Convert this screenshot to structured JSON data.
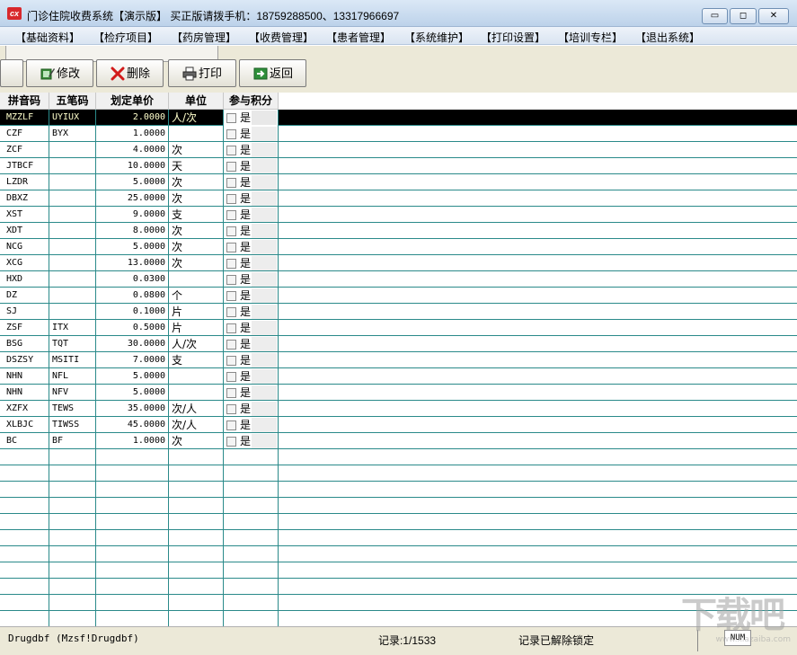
{
  "window": {
    "icon_text": "cx",
    "title": "门诊住院收费系统【演示版】 买正版请拨手机：18759288500、13317966697",
    "minimize_glyph": "▭",
    "maximize_glyph": "◻",
    "close_glyph": "✕"
  },
  "menu": [
    "【基础资料】",
    "【检疗项目】",
    "【药房管理】",
    "【收费管理】",
    "【患者管理】",
    "【系统维护】",
    "【打印设置】",
    "【培训专栏】",
    "【退出系统】"
  ],
  "toolbar": {
    "edit_label": "修改",
    "delete_label": "删除",
    "print_label": "打印",
    "back_label": "返回"
  },
  "grid": {
    "headers": [
      "拼音码",
      "五笔码",
      "划定单价",
      "单位",
      "参与积分"
    ],
    "checkbox_label": "是",
    "rows": [
      {
        "py": "MZZLF",
        "wb": "UYIUX",
        "price": "2.0000",
        "unit": "人/次",
        "selected": true
      },
      {
        "py": "CZF",
        "wb": "BYX",
        "price": "1.0000",
        "unit": ""
      },
      {
        "py": "ZCF",
        "wb": "",
        "price": "4.0000",
        "unit": "次"
      },
      {
        "py": "JTBCF",
        "wb": "",
        "price": "10.0000",
        "unit": "天"
      },
      {
        "py": "LZDR",
        "wb": "",
        "price": "5.0000",
        "unit": "次"
      },
      {
        "py": "DBXZ",
        "wb": "",
        "price": "25.0000",
        "unit": "次"
      },
      {
        "py": "XST",
        "wb": "",
        "price": "9.0000",
        "unit": "支"
      },
      {
        "py": "XDT",
        "wb": "",
        "price": "8.0000",
        "unit": "次"
      },
      {
        "py": "NCG",
        "wb": "",
        "price": "5.0000",
        "unit": "次"
      },
      {
        "py": "XCG",
        "wb": "",
        "price": "13.0000",
        "unit": "次"
      },
      {
        "py": "HXD",
        "wb": "",
        "price": "0.0300",
        "unit": ""
      },
      {
        "py": "DZ",
        "wb": "",
        "price": "0.0800",
        "unit": "个"
      },
      {
        "py": "SJ",
        "wb": "",
        "price": "0.1000",
        "unit": "片"
      },
      {
        "py": "ZSF",
        "wb": "ITX",
        "price": "0.5000",
        "unit": "片"
      },
      {
        "py": "BSG",
        "wb": "TQT",
        "price": "30.0000",
        "unit": "人/次"
      },
      {
        "py": "DSZSY",
        "wb": "MSITI",
        "price": "7.0000",
        "unit": "支"
      },
      {
        "py": "NHN",
        "wb": "NFL",
        "price": "5.0000",
        "unit": ""
      },
      {
        "py": "NHN",
        "wb": "NFV",
        "price": "5.0000",
        "unit": ""
      },
      {
        "py": "XZFX",
        "wb": "TEWS",
        "price": "35.0000",
        "unit": "次/人"
      },
      {
        "py": "XLBJC",
        "wb": "TIWSS",
        "price": "45.0000",
        "unit": "次/人"
      },
      {
        "py": "BC",
        "wb": "BF",
        "price": "1.0000",
        "unit": "次"
      }
    ],
    "empty_rows": 11
  },
  "status": {
    "table": "Drugdbf (Mzsf!Drugdbf)",
    "record": "记录:1/1533",
    "lock": "记录已解除锁定",
    "num": "NUM"
  },
  "watermark": {
    "main": "下载吧",
    "sub": "www.xiazaiba.com"
  },
  "colors": {
    "grid_line": "#2a8a8a",
    "selected_row_bg": "#000000",
    "selected_row_text": "#ffffcc",
    "panel_bg": "#ece9d8",
    "titlebar": "#c9dcf0"
  }
}
